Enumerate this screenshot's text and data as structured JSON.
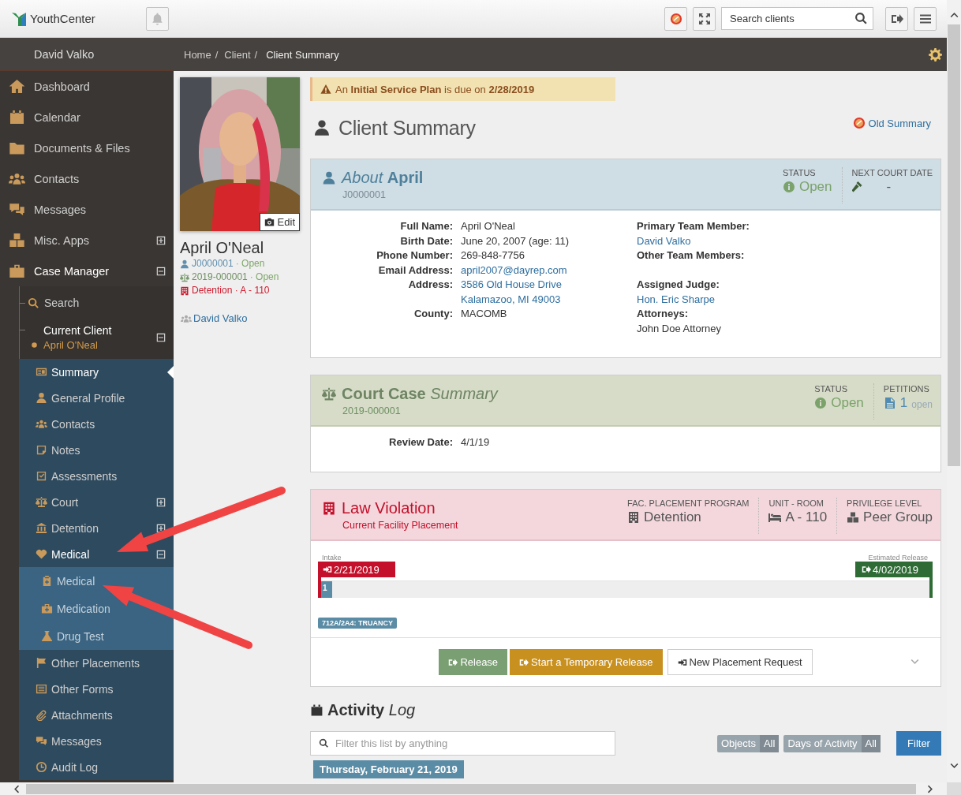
{
  "topbar": {
    "brand": "YouthCenter",
    "search": {
      "placeholder": "Search clients"
    }
  },
  "user_bar": {
    "name": "David Valko"
  },
  "breadcrumb": {
    "separator": "/",
    "items": [
      "Home",
      "Client",
      "Client Summary"
    ]
  },
  "sidebar": {
    "items": [
      {
        "label": "Dashboard",
        "selected": false
      },
      {
        "label": "Calendar",
        "selected": false
      },
      {
        "label": "Documents & Files",
        "selected": false
      },
      {
        "label": "Contacts",
        "selected": false
      },
      {
        "label": "Messages",
        "selected": false
      },
      {
        "label": "Misc. Apps",
        "selected": false,
        "expanded": false
      },
      {
        "label": "Case Manager",
        "selected": false,
        "expanded": true,
        "children": [
          {
            "label": "Search",
            "selected": false
          },
          {
            "label": "Current Client",
            "subtitle": "April O'Neal",
            "selected": false,
            "expanded": true,
            "children": [
              {
                "label": "Summary",
                "selected": true
              },
              {
                "label": "General Profile",
                "selected": false
              },
              {
                "label": "Contacts",
                "selected": false
              },
              {
                "label": "Notes",
                "selected": false
              },
              {
                "label": "Assessments",
                "selected": false
              },
              {
                "label": "Court",
                "selected": false,
                "expanded": false
              },
              {
                "label": "Detention",
                "selected": false,
                "expanded": false
              },
              {
                "label": "Medical",
                "selected": false,
                "expanded": true,
                "children": [
                  {
                    "label": "Medical",
                    "selected": false
                  },
                  {
                    "label": "Medication",
                    "selected": false
                  },
                  {
                    "label": "Drug Test",
                    "selected": false
                  }
                ]
              },
              {
                "label": "Other Placements",
                "selected": false
              },
              {
                "label": "Other Forms",
                "selected": false
              },
              {
                "label": "Attachments",
                "selected": false
              },
              {
                "label": "Messages",
                "selected": false
              },
              {
                "label": "Audit Log",
                "selected": false
              }
            ]
          }
        ]
      }
    ]
  },
  "client": {
    "name": "April O'Neal",
    "edit_label": "Edit",
    "team_member": "David Valko",
    "cases": [
      {
        "kind": "youth",
        "number": "J0000001",
        "status": "· Open"
      },
      {
        "kind": "court",
        "number": "2019-000001",
        "status": "· Open"
      },
      {
        "kind": "placement",
        "number": "Detention · A - 110"
      }
    ]
  },
  "alert": "An **Initial Service Plan** is due on **2/28/2019**",
  "page_title": "Client Summary",
  "old_summary_link": "Old Summary",
  "about": {
    "title": "*About* **April**",
    "subtitle": "J0000001",
    "stats": [
      {
        "kind": "status",
        "label": "STATUS",
        "value": "Open"
      },
      {
        "kind": "court_date",
        "label": "NEXT COURT DATE",
        "value": "-"
      }
    ],
    "fields": [
      {
        "label": "Full Name:",
        "values": [
          "April O'Neal"
        ]
      },
      {
        "label": "Birth Date:",
        "values": [
          "June 20, 2007 (age: 11)"
        ]
      },
      {
        "label": "Phone Number:",
        "values": [
          "269-848-7756"
        ]
      },
      {
        "label": "Email Address:",
        "values": [
          "april2007@dayrep.com"
        ],
        "link": true
      },
      {
        "label": "Address:",
        "values": [
          "3586 Old House Drive",
          "Kalamazoo, MI 49003"
        ],
        "link": true
      },
      {
        "label": "County:",
        "values": [
          "MACOMB"
        ]
      }
    ],
    "side_fields": [
      {
        "label": "Primary Team Member:",
        "value": "David Valko",
        "link": true
      },
      {
        "label": "Other Team Members:"
      },
      {
        "label": "Assigned Judge:",
        "value": "Hon. Eric Sharpe",
        "link": true
      },
      {
        "label": "Attorneys:",
        "value": "John Doe Attorney"
      }
    ]
  },
  "court": {
    "title": "**Court Case** *Summary*",
    "subtitle": "2019-000001",
    "stats": [
      {
        "kind": "status",
        "label": "STATUS",
        "value": "Open"
      },
      {
        "kind": "petitions",
        "label": "PETITIONS",
        "value": "1",
        "note": "open"
      }
    ],
    "fields": [
      {
        "label": "Review Date:",
        "values": [
          "4/1/19"
        ]
      }
    ]
  },
  "placement": {
    "title": "Law Violation",
    "subtitle": "Current Facility Placement",
    "stats": [
      {
        "kind": "program",
        "label": "FAC. PLACEMENT PROGRAM",
        "value": "Detention"
      },
      {
        "kind": "room",
        "label": "UNIT - ROOM",
        "value": "A - 110"
      },
      {
        "kind": "privilege",
        "label": "PRIVILEGE LEVEL",
        "value": "Peer Group"
      }
    ],
    "timeline": {
      "start_label": "Intake",
      "start_date": "2/21/2019",
      "end_label": "Estimated Release",
      "end_date": "4/02/2019",
      "marker": {
        "label": "1",
        "level": 0.018
      }
    },
    "charges": [
      "712A/2A4: TRUANCY"
    ],
    "actions": [
      {
        "kind": "release",
        "label": "Release"
      },
      {
        "kind": "temporary",
        "label": "Start a Temporary Release"
      },
      {
        "kind": "request",
        "label": "New Placement Request"
      }
    ]
  },
  "activity": {
    "title": "**Activity** *Log*",
    "filter": {
      "placeholder": "Filter this list by anything"
    },
    "chips": [
      {
        "label": "Objects",
        "value": "All"
      },
      {
        "label": "Days of Activity",
        "value": "All"
      }
    ],
    "filter_button": "Filter",
    "days": [
      "Thursday, February 21, 2019"
    ]
  }
}
